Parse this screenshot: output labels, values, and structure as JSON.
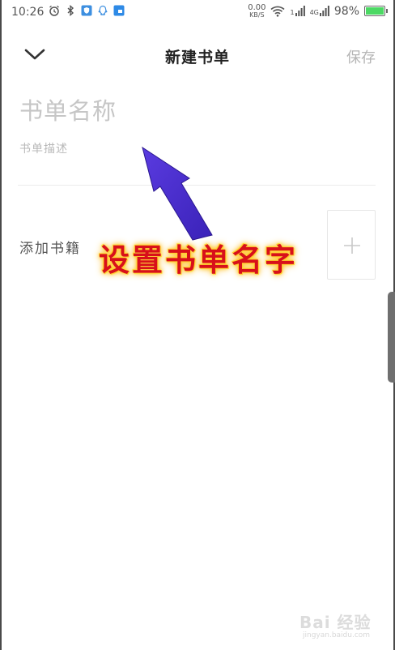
{
  "status_bar": {
    "time": "10:26",
    "net_speed_value": "0.00",
    "net_speed_unit": "KB/S",
    "signal_1": "1",
    "signal_2": "4G",
    "battery_percent": "98%",
    "battery_level": 0.98
  },
  "nav": {
    "title": "新建书单",
    "save_label": "保存",
    "back_icon": "chevron-down-icon"
  },
  "form": {
    "name_placeholder": "书单名称",
    "name_value": "",
    "desc_placeholder": "书单描述",
    "desc_value": "",
    "add_books_label": "添加书籍"
  },
  "annotation": {
    "caption": "设置书单名字",
    "arrow_color": "#4a2fd0",
    "caption_color": "#d8101a"
  },
  "watermark": {
    "brand": "Bai 经验",
    "url": "jingyan.baidu.com"
  },
  "colors": {
    "title": "#222222",
    "placeholder": "#c6c6c6",
    "save_disabled": "#b5b5b5"
  }
}
